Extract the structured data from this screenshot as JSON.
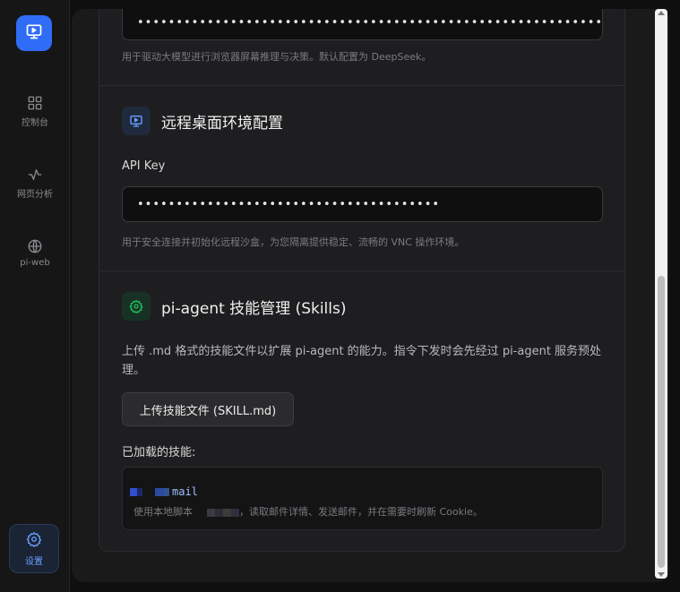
{
  "sidebar": {
    "logo_icon": "monitor-play-icon",
    "items": [
      {
        "label": "控制台",
        "icon": "grid-icon"
      },
      {
        "label": "网页分析",
        "icon": "activity-icon"
      },
      {
        "label": "pi-web",
        "icon": "globe-icon"
      }
    ],
    "settings": {
      "label": "设置",
      "icon": "gear-icon"
    }
  },
  "model_section": {
    "api_key_value": "••••••••••••••••••••••••••••••••••••••••••••••••••••••••••••",
    "hint": "用于驱动大模型进行浏览器屏幕推理与决策。默认配置为 DeepSeek。"
  },
  "remote_desktop": {
    "title": "远程桌面环境配置",
    "icon": "monitor-icon",
    "api_key_label": "API Key",
    "api_key_value": "•••••••••••••••••••••••••••••••••••••••",
    "hint": "用于安全连接并初始化远程沙盒，为您隔离提供稳定、流畅的 VNC 操作环境。"
  },
  "skills": {
    "title": "pi-agent 技能管理 (Skills)",
    "icon": "gear-icon",
    "description": "上传 .md 格式的技能文件以扩展 pi-agent 的能力。指令下发时会先经过 pi-agent 服务预处理。",
    "upload_button": "上传技能文件 (SKILL.md)",
    "loaded_label": "已加载的技能:",
    "loaded": [
      {
        "name": "mail",
        "desc_prefix": "使用本地脚本",
        "desc_suffix": "，读取邮件详情、发送邮件，并在需要时刷新 Cookie。"
      }
    ]
  },
  "colors": {
    "accent": "#2f6df6",
    "skills_icon": "#22c55e",
    "monitor_icon": "#6aa0ff"
  }
}
